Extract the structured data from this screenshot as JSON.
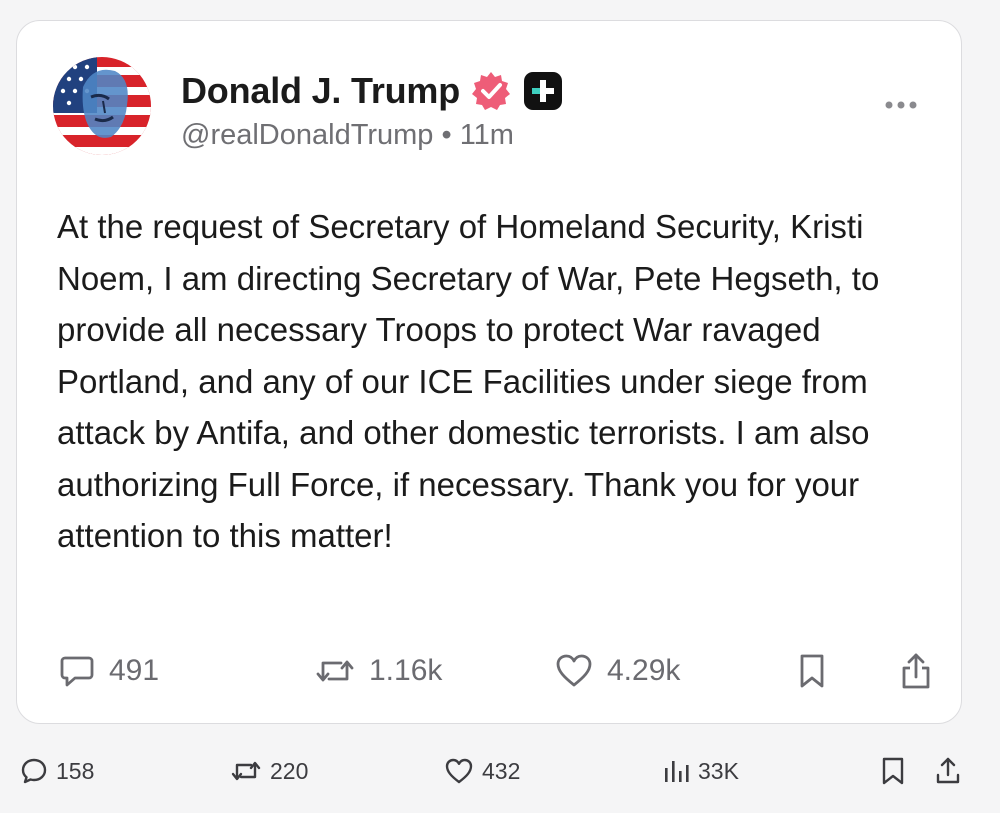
{
  "post": {
    "display_name": "Donald J. Trump",
    "handle": "@realDonaldTrump",
    "separator": "•",
    "time": "11m",
    "text": "At the request of Secretary of Homeland Security, Kristi Noem, I am directing Secretary of War, Pete Hegseth, to provide all necessary Troops to protect War ravaged Portland, and any of our ICE Facilities under siege from attack by Antifa, and other domestic terrorists. I am also authorizing Full Force, if necessary. Thank you for your attention to this matter!",
    "actions": {
      "replies": "491",
      "reposts": "1.16k",
      "likes": "4.29k"
    },
    "icons": {
      "verified": "verified-badge-icon",
      "platform": "plus-square-icon",
      "more": "more-dots-icon",
      "reply": "speech-bubble-icon",
      "repost": "repost-arrows-icon",
      "like": "heart-icon",
      "bookmark": "bookmark-icon",
      "share": "share-up-icon"
    },
    "colors": {
      "verified_badge": "#ee5d78",
      "text": "#1b1b1b",
      "muted": "#6f6f73"
    }
  },
  "outer_actions": {
    "replies": "158",
    "reposts": "220",
    "likes": "432",
    "views": "33K"
  }
}
